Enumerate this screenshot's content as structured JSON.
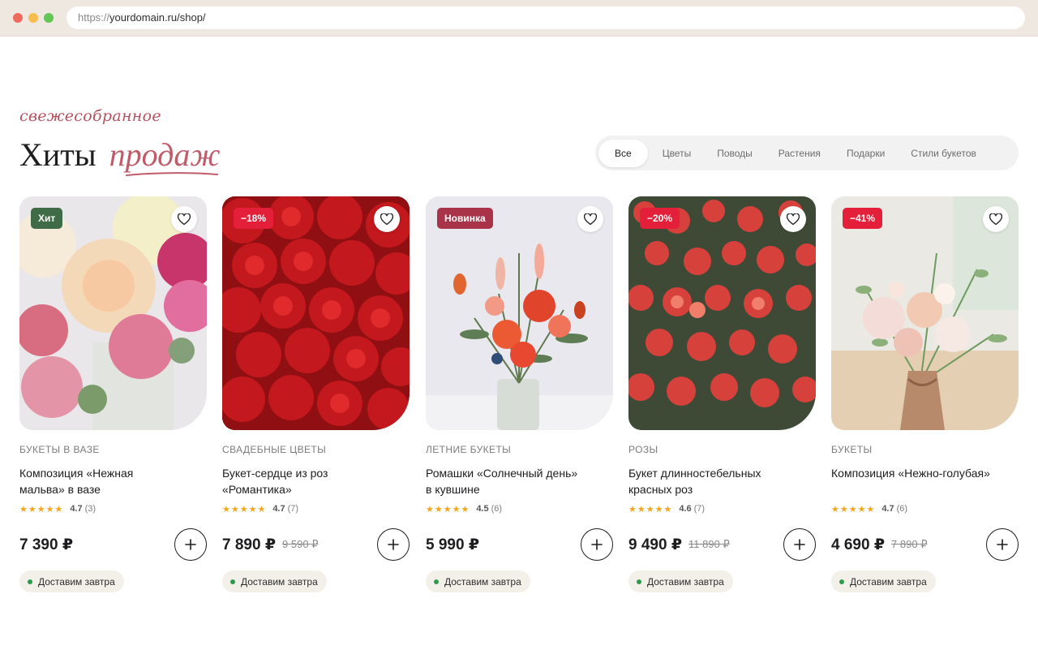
{
  "browser": {
    "url_scheme": "https://",
    "url_rest": "yourdomain.ru/shop/"
  },
  "section": {
    "kicker": "свежесобранное",
    "title_main": "Хиты",
    "title_accent": "продаж"
  },
  "tabs": [
    {
      "label": "Все",
      "active": true
    },
    {
      "label": "Цветы",
      "active": false
    },
    {
      "label": "Поводы",
      "active": false
    },
    {
      "label": "Растения",
      "active": false
    },
    {
      "label": "Подарки",
      "active": false
    },
    {
      "label": "Стили букетов",
      "active": false
    }
  ],
  "products": [
    {
      "badge": "Хит",
      "badge_type": "hit",
      "category": "Букеты в вазе",
      "name": "Композиция «Нежная мальва» в вазе",
      "stars": "★★★★★",
      "rating": "4.7",
      "reviews": "(3)",
      "price": "7 390 ₽",
      "old_price": "",
      "delivery": "Доставим завтра"
    },
    {
      "badge": "−18%",
      "badge_type": "sale",
      "category": "Свадебные цветы",
      "name": "Букет-сердце из роз «Романтика»",
      "stars": "★★★★★",
      "rating": "4.7",
      "reviews": "(7)",
      "price": "7 890 ₽",
      "old_price": "9 590 ₽",
      "delivery": "Доставим завтра"
    },
    {
      "badge": "Новинка",
      "badge_type": "new",
      "category": "Летние букеты",
      "name": "Ромашки «Солнечный день» в кувшине",
      "stars": "★★★★★",
      "rating": "4.5",
      "reviews": "(6)",
      "price": "5 990 ₽",
      "old_price": "",
      "delivery": "Доставим завтра"
    },
    {
      "badge": "−20%",
      "badge_type": "sale",
      "category": "Розы",
      "name": "Букет длинностебельных красных роз",
      "stars": "★★★★★",
      "rating": "4.6",
      "reviews": "(7)",
      "price": "9 490 ₽",
      "old_price": "11 890 ₽",
      "delivery": "Доставим завтра"
    },
    {
      "badge": "−41%",
      "badge_type": "sale",
      "category": "Букеты",
      "name": "Композиция «Нежно-голубая»",
      "stars": "★★★★★",
      "rating": "4.7",
      "reviews": "(6)",
      "price": "4 690 ₽",
      "old_price": "7 890 ₽",
      "delivery": "Доставим завтра"
    }
  ],
  "colors": {
    "accent": "#c05c6a",
    "sale_badge": "#e41f3a",
    "hit_badge": "#3f6b46",
    "new_badge": "#a9344a",
    "star": "#f4a51c",
    "delivery_dot": "#2e9a4a"
  },
  "icons": {
    "favorite": "heart-icon",
    "add_to_cart": "plus-icon",
    "rating": "star-icon"
  }
}
